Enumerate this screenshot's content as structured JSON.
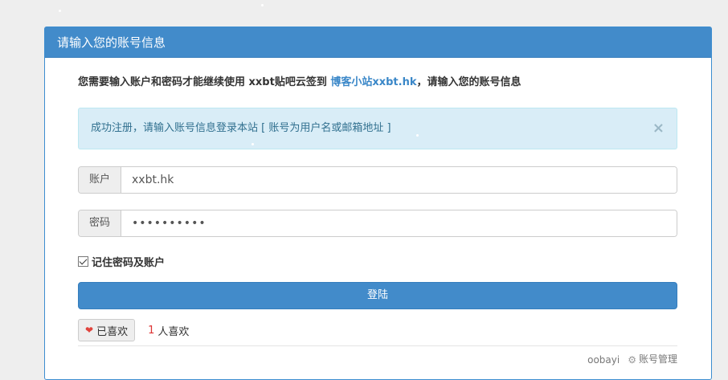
{
  "panel": {
    "title": "请输入您的账号信息"
  },
  "intro": {
    "prefix": "您需要输入账户和密码才能继续使用 xxbt贴吧云签到 ",
    "site_link": "博客小站xxbt.hk",
    "suffix": "，请输入您的账号信息"
  },
  "alert": {
    "message": "成功注册，请输入账号信息登录本站 [ 账号为用户名或邮箱地址 ]",
    "close_label": "×"
  },
  "form": {
    "account_label": "账户",
    "account_value": "xxbt.hk",
    "password_label": "密码",
    "password_value": "**********",
    "remember_label": "记住密码及账户",
    "remember_checked": true,
    "submit_label": "登陆"
  },
  "like": {
    "button_label": "已喜欢",
    "count": "1",
    "count_label": "人喜欢"
  },
  "footer": {
    "user": "oobayi",
    "manage_label": "账号管理"
  },
  "colors": {
    "primary": "#428bca",
    "alert_bg": "#d9edf7",
    "alert_text": "#31708f",
    "link": "#3a87c8",
    "heart": "#e0433c"
  }
}
